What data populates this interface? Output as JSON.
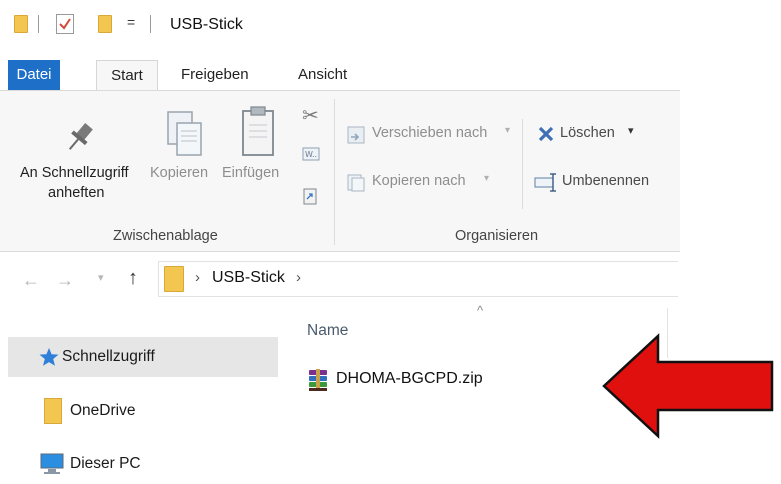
{
  "window": {
    "title": "USB-Stick"
  },
  "quick_access": {
    "dropdown_glyph": "="
  },
  "ribbon_tabs": [
    {
      "label": "Datei"
    },
    {
      "label": "Start"
    },
    {
      "label": "Freigeben"
    },
    {
      "label": "Ansicht"
    }
  ],
  "ribbon": {
    "pin": {
      "line1": "An Schnellzugriff",
      "line2": "anheften"
    },
    "copy": "Kopieren",
    "paste": "Einfügen",
    "move_to": "Verschieben nach",
    "copy_to": "Kopieren nach",
    "delete": "Löschen",
    "rename": "Umbenennen",
    "groups": {
      "clipboard": "Zwischenablage",
      "organize": "Organisieren"
    }
  },
  "address_bar": {
    "location": "USB-Stick"
  },
  "nav_pane": [
    {
      "label": "Schnellzugriff",
      "icon": "star-icon",
      "selected": true
    },
    {
      "label": "OneDrive",
      "icon": "folder-icon"
    },
    {
      "label": "Dieser PC",
      "icon": "computer-icon"
    }
  ],
  "content": {
    "column_name": "Name",
    "sort_glyph": "^",
    "files": [
      {
        "name": "DHOMA-BGCPD.zip",
        "icon": "winrar-archive-icon"
      }
    ]
  },
  "colors": {
    "accent": "#1e6fc7",
    "arrow": "#e0100f",
    "folder": "#f3c74f"
  }
}
